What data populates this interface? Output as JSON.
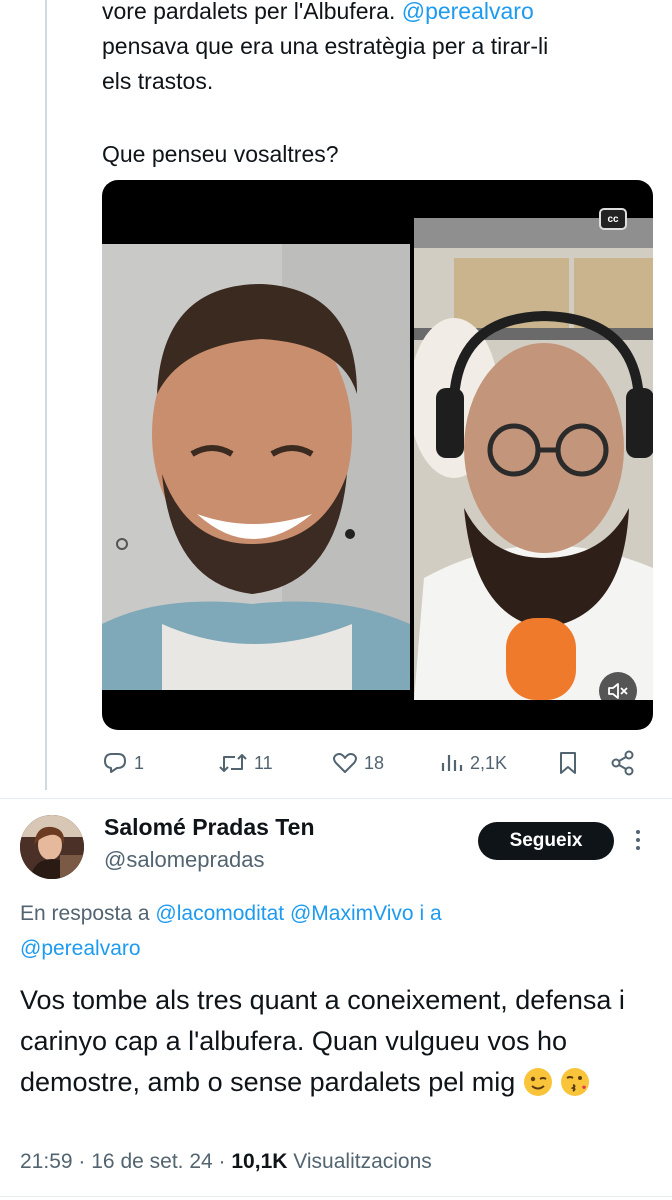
{
  "tweet": {
    "line1_text": "vore pardalets per l'Albufera. ",
    "line1_mention": "@perealvaro",
    "line2": "pensava que era una estratègia per a tirar-li",
    "line3": "els trastos.",
    "line4": "Que penseu vosaltres?",
    "media": {
      "cc_label": "cc"
    },
    "actions": {
      "replies": "1",
      "retweets": "11",
      "likes": "18",
      "views": "2,1K"
    }
  },
  "reply": {
    "author_name": "Salomé Pradas Ten",
    "author_handle": "@salomepradas",
    "follow_label": "Segueix",
    "reply_prefix": "En resposta a ",
    "mention1": "@lacomoditat",
    "mention2": "@MaximVivo",
    "joiner": " i a",
    "mention3": "@perealvaro",
    "body": "Vos tombe als tres quant a coneixement, defensa i carinyo cap a l'albufera. Quan vulgueu vos ho demostre, amb o sense pardalets pel mig",
    "time": "21:59",
    "sep": "·",
    "date": "16 de set. 24",
    "views_count": "10,1K",
    "views_label": "Visualitzacions"
  },
  "colors": {
    "accent": "#1d9bf0",
    "text": "#0f1419",
    "muted": "#536471",
    "button_bg": "#0f1419"
  },
  "icons": [
    "reply-icon",
    "retweet-icon",
    "like-icon",
    "views-icon",
    "bookmark-icon",
    "share-icon",
    "cc-icon",
    "mute-icon",
    "more-icon"
  ]
}
